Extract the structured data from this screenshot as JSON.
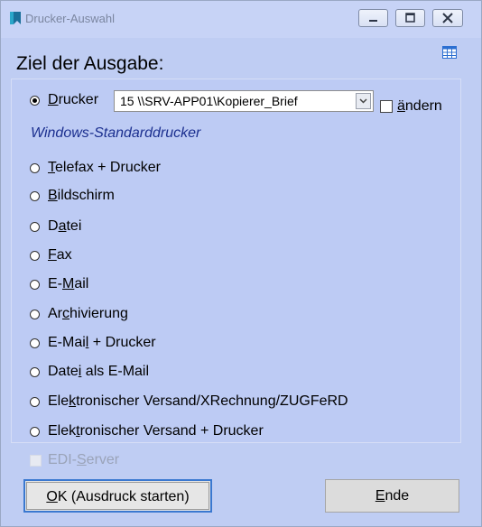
{
  "window": {
    "title": "Drucker-Auswahl"
  },
  "heading": "Ziel der Ausgabe:",
  "printer": {
    "label_pre": "",
    "label_u": "D",
    "label_post": "rucker",
    "selected_value": "15 \\\\SRV-APP01\\Kopierer_Brief",
    "change_pre": "",
    "change_u": "ä",
    "change_post": "ndern",
    "default_hint": "Windows-Standarddrucker"
  },
  "options": [
    {
      "pre": "",
      "u": "T",
      "post": "elefax + Drucker"
    },
    {
      "pre": "",
      "u": "B",
      "post": "ildschirm"
    },
    {
      "pre": "D",
      "u": "a",
      "post": "tei"
    },
    {
      "pre": "",
      "u": "F",
      "post": "ax"
    },
    {
      "pre": "E-",
      "u": "M",
      "post": "ail"
    },
    {
      "pre": "Ar",
      "u": "c",
      "post": "hivierung"
    },
    {
      "pre": "E-Mai",
      "u": "l",
      "post": " + Drucker"
    },
    {
      "pre": "Date",
      "u": "i",
      "post": " als E-Mail"
    },
    {
      "pre": "Ele",
      "u": "k",
      "post": "tronischer Versand/XRechnung/ZUGFeRD"
    },
    {
      "pre": "Elek",
      "u": "t",
      "post": "ronischer Versand + Drucker"
    }
  ],
  "edi": {
    "pre": "EDI-",
    "u": "S",
    "post": "erver"
  },
  "buttons": {
    "ok": {
      "pre": "",
      "u": "O",
      "post": "K (Ausdruck starten)"
    },
    "end": {
      "pre": "",
      "u": "E",
      "post": "nde"
    }
  },
  "colors": {
    "window_bg": "#bfcdf3",
    "hint": "#1b2f8f",
    "focus": "#3a78d0",
    "icon": "#1f7ea6"
  }
}
